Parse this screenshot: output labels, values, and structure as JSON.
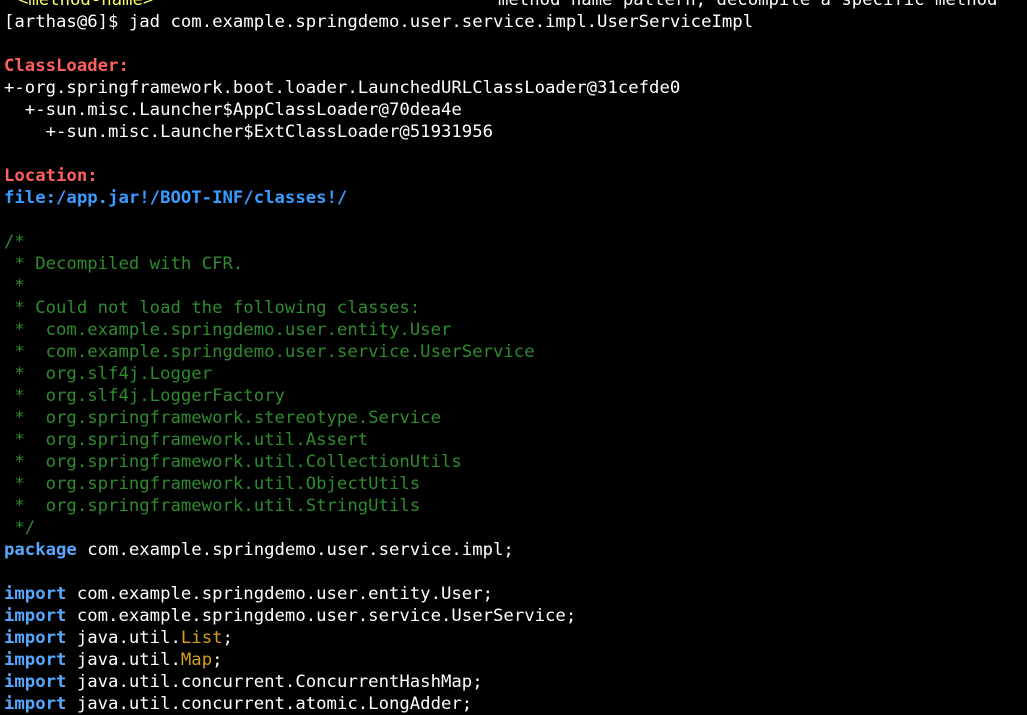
{
  "terminal": {
    "top_cutoff": {
      "left": "<method-name>",
      "right": "method name pattern, decompile a specific method"
    },
    "prompt": "[arthas@6]$ ",
    "command": "jad com.example.springdemo.user.service.impl.UserServiceImpl",
    "classloader_label": "ClassLoader:",
    "classloader_lines": [
      "+-org.springframework.boot.loader.LaunchedURLClassLoader@31cefde0",
      "  +-sun.misc.Launcher$AppClassLoader@70dea4e",
      "    +-sun.misc.Launcher$ExtClassLoader@51931956"
    ],
    "location_label": "Location:",
    "location_value": "file:/app.jar!/BOOT-INF/classes!/",
    "comment_lines": [
      "/*",
      " * Decompiled with CFR.",
      " *",
      " * Could not load the following classes:",
      " *  com.example.springdemo.user.entity.User",
      " *  com.example.springdemo.user.service.UserService",
      " *  org.slf4j.Logger",
      " *  org.slf4j.LoggerFactory",
      " *  org.springframework.stereotype.Service",
      " *  org.springframework.util.Assert",
      " *  org.springframework.util.CollectionUtils",
      " *  org.springframework.util.ObjectUtils",
      " *  org.springframework.util.StringUtils",
      " */"
    ],
    "package_keyword": "package",
    "package_name": " com.example.springdemo.user.service.impl;",
    "import_keyword": "import",
    "imports": [
      {
        "prefix": " com.example.springdemo.user.entity.User;",
        "type": "",
        "suffix": ""
      },
      {
        "prefix": " com.example.springdemo.user.service.UserService;",
        "type": "",
        "suffix": ""
      },
      {
        "prefix": " java.util.",
        "type": "List",
        "suffix": ";"
      },
      {
        "prefix": " java.util.",
        "type": "Map",
        "suffix": ";"
      },
      {
        "prefix": " java.util.concurrent.ConcurrentHashMap;",
        "type": "",
        "suffix": ""
      },
      {
        "prefix": " java.util.concurrent.atomic.LongAdder;",
        "type": "",
        "suffix": ""
      }
    ]
  }
}
